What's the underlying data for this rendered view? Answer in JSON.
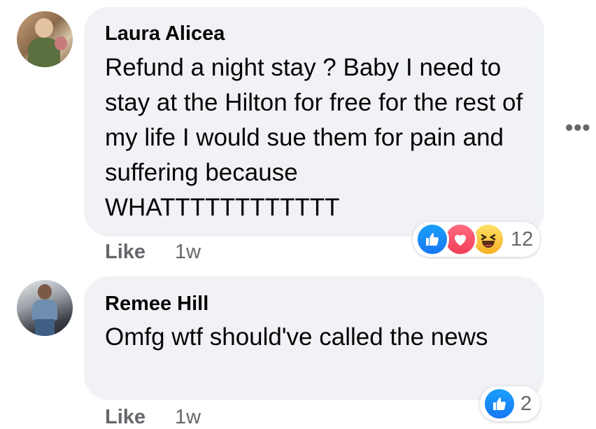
{
  "comments": [
    {
      "author": "Laura Alicea",
      "text": "Refund a night stay ? Baby I need to stay at the Hilton for free for the rest of my life I would sue them for pain and suffering because WHATTTTTTTTTTTT",
      "like_label": "Like",
      "time": "1w",
      "reactions": [
        "like",
        "love",
        "haha"
      ],
      "reaction_count": "12"
    },
    {
      "author": "Remee Hill",
      "text": "Omfg wtf should've called the news",
      "like_label": "Like",
      "time": "1w",
      "reactions": [
        "like"
      ],
      "reaction_count": "2"
    }
  ],
  "more_options_icon": "more-horizontal-icon",
  "colors": {
    "bubble": "#f0f2f5",
    "meta_text": "#65676b",
    "like_blue": "#1877f2",
    "love_red": "#f33e58",
    "haha_yellow": "#f7b125"
  }
}
